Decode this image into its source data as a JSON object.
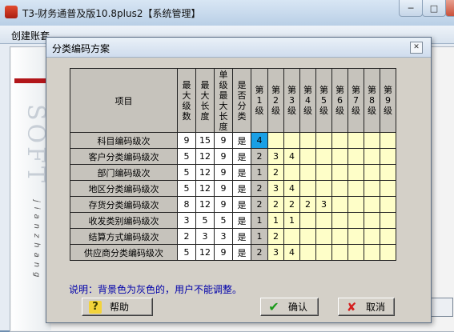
{
  "window": {
    "title": "T3-财务通普及版10.8plus2【系统管理】",
    "minimize": "─",
    "maximize": "□",
    "close": "✕"
  },
  "child_window": {
    "title": "创建账套"
  },
  "wizard": {
    "watermark": "SOFT",
    "vertical_text": "jianzhang"
  },
  "dialog": {
    "title": "分类编码方案",
    "close": "✕",
    "table": {
      "headers": {
        "item": "项目",
        "max_levels": "最大级数",
        "max_length": "最大长度",
        "single_max": "单级最大长度",
        "leaf_only": "是否分类",
        "levels": [
          "第1级",
          "第2级",
          "第3级",
          "第4级",
          "第5级",
          "第6级",
          "第7级",
          "第8级",
          "第9级"
        ]
      },
      "rows": [
        {
          "name": "科目编码级次",
          "max_levels": "9",
          "max_length": "15",
          "single_max": "9",
          "flag": "是",
          "levels": [
            "4",
            "",
            "",
            "",
            "",
            "",
            "",
            "",
            ""
          ]
        },
        {
          "name": "客户分类编码级次",
          "max_levels": "5",
          "max_length": "12",
          "single_max": "9",
          "flag": "是",
          "levels": [
            "2",
            "3",
            "4",
            "",
            "",
            "",
            "",
            "",
            ""
          ]
        },
        {
          "name": "部门编码级次",
          "max_levels": "5",
          "max_length": "12",
          "single_max": "9",
          "flag": "是",
          "levels": [
            "1",
            "2",
            "",
            "",
            "",
            "",
            "",
            "",
            ""
          ]
        },
        {
          "name": "地区分类编码级次",
          "max_levels": "5",
          "max_length": "12",
          "single_max": "9",
          "flag": "是",
          "levels": [
            "2",
            "3",
            "4",
            "",
            "",
            "",
            "",
            "",
            ""
          ]
        },
        {
          "name": "存货分类编码级次",
          "max_levels": "8",
          "max_length": "12",
          "single_max": "9",
          "flag": "是",
          "levels": [
            "2",
            "2",
            "2",
            "2",
            "3",
            "",
            "",
            "",
            ""
          ]
        },
        {
          "name": "收发类别编码级次",
          "max_levels": "3",
          "max_length": "5",
          "single_max": "5",
          "flag": "是",
          "levels": [
            "1",
            "1",
            "1",
            "",
            "",
            "",
            "",
            "",
            ""
          ]
        },
        {
          "name": "结算方式编码级次",
          "max_levels": "2",
          "max_length": "3",
          "single_max": "3",
          "flag": "是",
          "levels": [
            "1",
            "2",
            "",
            "",
            "",
            "",
            "",
            "",
            ""
          ]
        },
        {
          "name": "供应商分类编码级次",
          "max_levels": "5",
          "max_length": "12",
          "single_max": "9",
          "flag": "是",
          "levels": [
            "2",
            "3",
            "4",
            "",
            "",
            "",
            "",
            "",
            ""
          ]
        }
      ]
    },
    "note": "说明：背景色为灰色的，用户不能调整。",
    "buttons": {
      "help": "帮助",
      "ok": "确认",
      "cancel": "取消"
    },
    "icons": {
      "help": "question-mark",
      "ok": "green-checkmark",
      "cancel": "red-x"
    },
    "colors": {
      "editable_cell": "#fefec8",
      "active_cell": "#1aa0e6",
      "readonly_cell": "#c6c3bc",
      "note_text": "#0000aa"
    }
  }
}
